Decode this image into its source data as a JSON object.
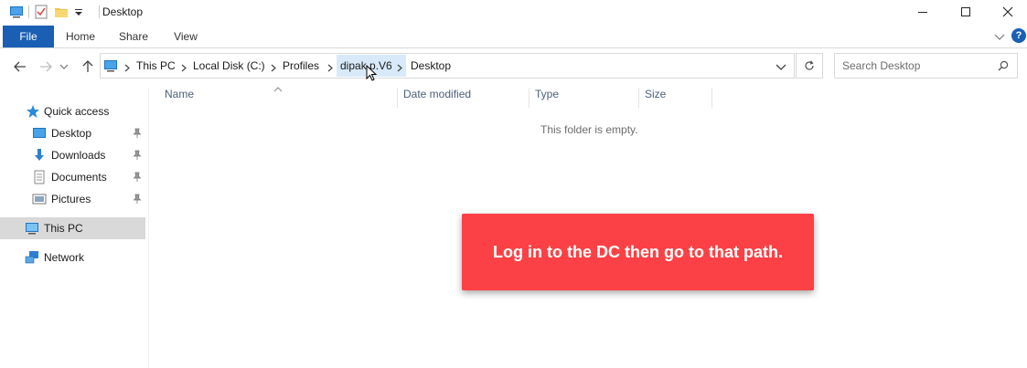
{
  "window": {
    "title": "Desktop"
  },
  "ribbon": {
    "tabs": [
      "File",
      "Home",
      "Share",
      "View"
    ],
    "help_label": "?"
  },
  "address": {
    "crumbs": [
      "This PC",
      "Local Disk (C:)",
      "Profiles",
      "dipak.p.V6",
      "Desktop"
    ]
  },
  "search": {
    "placeholder": "Search Desktop"
  },
  "nav": {
    "quick_access": "Quick access",
    "items": [
      "Desktop",
      "Downloads",
      "Documents",
      "Pictures"
    ],
    "this_pc": "This PC",
    "network": "Network"
  },
  "columns": [
    "Name",
    "Date modified",
    "Type",
    "Size"
  ],
  "content": {
    "empty_message": "This folder is empty."
  },
  "callout": {
    "text": "Log in to the DC then go to that path.",
    "color": "#fb4145"
  },
  "colors": {
    "accent": "#1a5fb4",
    "selection": "#d9d9d9",
    "hover": "#d8eaf9"
  }
}
